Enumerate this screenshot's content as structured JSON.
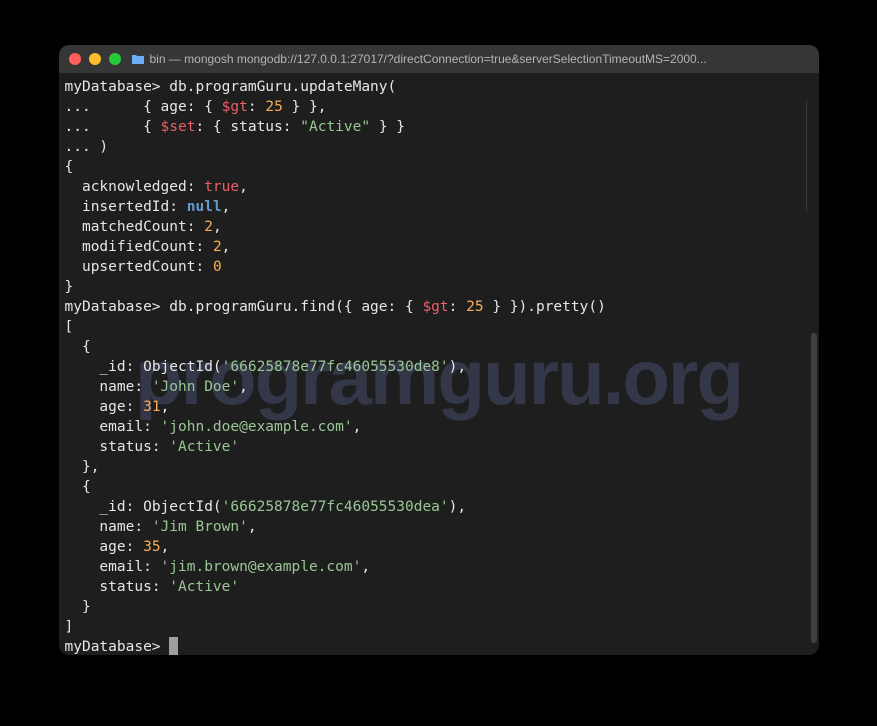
{
  "window": {
    "title": "bin — mongosh mongodb://127.0.0.1:27017/?directConnection=true&serverSelectionTimeoutMS=2000..."
  },
  "watermark": "programguru.org",
  "prompt": "myDatabase>",
  "cmd1": {
    "part1": "db.programGuru.updateMany(",
    "line2": {
      "cont": "...      ",
      "open": "{ ",
      "k1": "age",
      "sep1": ": { ",
      "op": "$gt",
      "sep2": ": ",
      "val": "25",
      "close": " } },"
    },
    "line3": {
      "cont": "...      ",
      "open": "{ ",
      "op": "$set",
      "sep1": ": { ",
      "k1": "status",
      "sep2": ": ",
      "val": "\"Active\"",
      "close": " } }"
    },
    "line4": "... )"
  },
  "result1": {
    "open": "{",
    "ack_k": "acknowledged",
    "ack_v": "true",
    "ins_k": "insertedId",
    "ins_v": "null",
    "mc_k": "matchedCount",
    "mc_v": "2",
    "mod_k": "modifiedCount",
    "mod_v": "2",
    "up_k": "upsertedCount",
    "up_v": "0",
    "close": "}"
  },
  "cmd2": {
    "pre": "db.programGuru.find({ ",
    "k1": "age",
    "sep1": ": { ",
    "op": "$gt",
    "sep2": ": ",
    "val": "25",
    "post": " } }).pretty()"
  },
  "find": {
    "open": "[",
    "docs": [
      {
        "id_v": "'66625878e77fc46055530de8'",
        "name_v": "'John Doe'",
        "age_v": "31",
        "email_v": "'john.doe@example.com'",
        "status_v": "'Active'"
      },
      {
        "id_v": "'66625878e77fc46055530dea'",
        "name_v": "'Jim Brown'",
        "age_v": "35",
        "email_v": "'jim.brown@example.com'",
        "status_v": "'Active'"
      }
    ],
    "close": "]"
  },
  "labels": {
    "id": "_id",
    "objid": "ObjectId(",
    "objid_close": "),",
    "name": "name",
    "age": "age",
    "email": "email",
    "status": "status"
  }
}
